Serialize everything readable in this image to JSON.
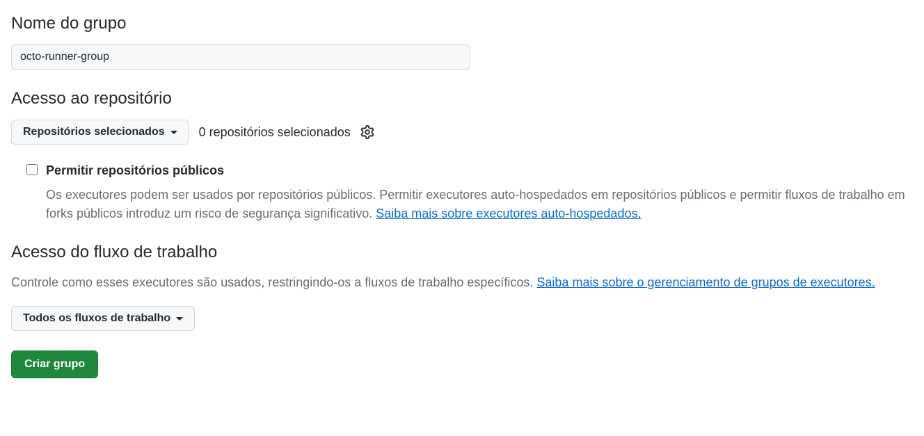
{
  "group_name": {
    "heading": "Nome do grupo",
    "value": "octo-runner-group"
  },
  "repo_access": {
    "heading": "Acesso ao repositório",
    "dropdown_label": "Repositórios selecionados",
    "count_text": "0 repositórios selecionados",
    "allow_public": {
      "checked": false,
      "label": "Permitir repositórios públicos",
      "description_prefix": "Os executores podem ser usados por repositórios públicos. Permitir executores auto-hospedados em repositórios públicos e permitir fluxos de trabalho em forks públicos introduz um risco de segurança significativo. ",
      "link_text": "Saiba mais sobre executores auto-hospedados."
    }
  },
  "workflow_access": {
    "heading": "Acesso do fluxo de trabalho",
    "description_prefix": "Controle como esses executores são usados, restringindo-os a fluxos de trabalho específicos. ",
    "link_text": "Saiba mais sobre o gerenciamento de grupos de executores.",
    "dropdown_label": "Todos os fluxos de trabalho"
  },
  "submit": {
    "label": "Criar grupo"
  }
}
